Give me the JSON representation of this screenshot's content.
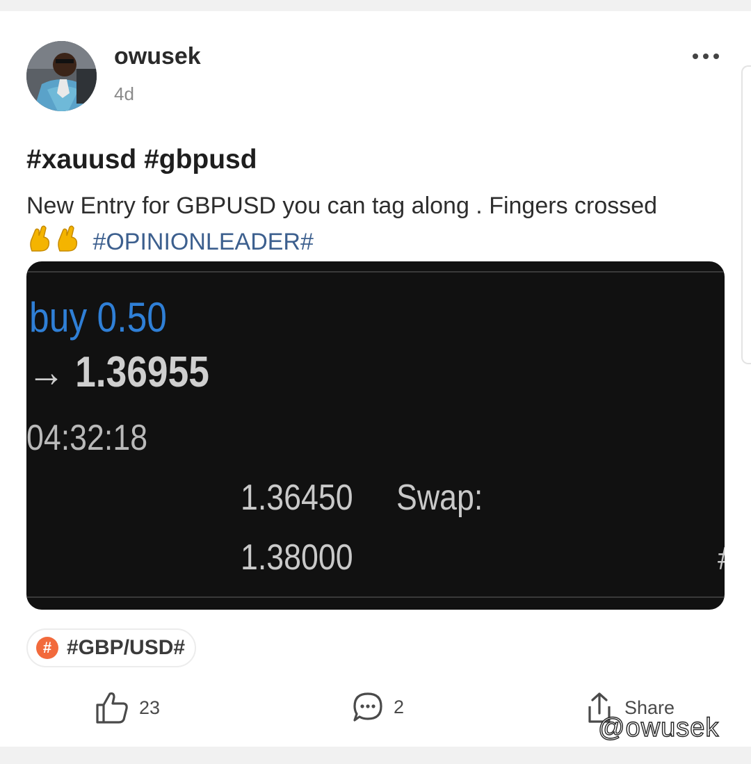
{
  "post": {
    "username": "owusek",
    "time": "4d",
    "title": "#xauusd #gbpusd",
    "body": "New Entry for GBPUSD you can tag along . Fingers crossed",
    "emojis": "🤞🤞",
    "body_hashtag": "#OPINIONLEADER#"
  },
  "screenshot": {
    "side_volume": "buy 0.50",
    "open_price": "1.36955",
    "arrow": "→",
    "time": "04:32:18",
    "stop_loss": "1.36450",
    "swap_label": "Swap:",
    "take_profit": "1.38000",
    "cut_char": "#"
  },
  "topic": {
    "icon": "#",
    "label": "#GBP/USD#"
  },
  "actions": {
    "likes": "23",
    "comments": "2",
    "share_label": "Share"
  },
  "watermark": "@owusek"
}
